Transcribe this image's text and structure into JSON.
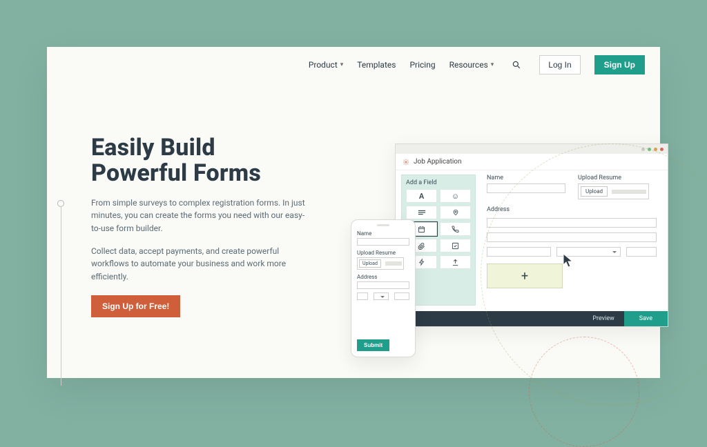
{
  "nav": {
    "product": "Product",
    "templates": "Templates",
    "pricing": "Pricing",
    "resources": "Resources",
    "login": "Log In",
    "signup": "Sign Up"
  },
  "hero": {
    "title_line1": "Easily Build",
    "title_line2": "Powerful Forms",
    "para1": "From simple surveys to complex registration forms. In just minutes, you can create the forms you need with our easy-to-use form builder.",
    "para2": "Collect data, accept payments, and create powerful workflows to automate your business and work more efficiently.",
    "cta": "Sign Up for Free!"
  },
  "builder": {
    "window_title": "Job Application",
    "palette_title": "Add a Field",
    "labels": {
      "name": "Name",
      "upload_resume": "Upload Resume",
      "upload_btn": "Upload",
      "address": "Address"
    },
    "footer": {
      "preview": "Preview",
      "save": "Save"
    },
    "dropzone": "+"
  },
  "mobile": {
    "name": "Name",
    "upload_resume": "Upload Resume",
    "upload_btn": "Upload",
    "address": "Address",
    "submit": "Submit"
  }
}
